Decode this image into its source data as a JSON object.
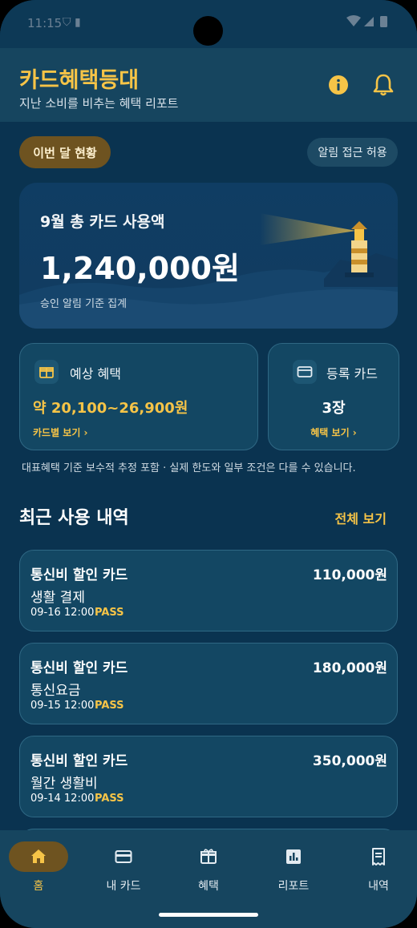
{
  "status_bar": {
    "time": "11:15",
    "left_icons": "⛉ ▮"
  },
  "header": {
    "title": "카드혜택등대",
    "subtitle": "지난 소비를 비추는 혜택 리포트",
    "info_icon": "info-icon",
    "bell_icon": "bell-icon"
  },
  "chips": {
    "month": "이번 달 현황",
    "allow": "알림 접근 허용"
  },
  "hero": {
    "label": "9월 총 카드 사용액",
    "amount": "1,240,000원",
    "note": "승인 알림 기준 집계"
  },
  "benefit_card": {
    "title": "예상 혜택",
    "value": "약 20,100~26,900원",
    "link": "카드별 보기  ›"
  },
  "cards_card": {
    "title": "등록 카드",
    "value": "3장",
    "link": "혜택 보기  ›"
  },
  "disclaimer": "대표혜택 기준 보수적 추정 포함 · 실제 한도와 일부 조건은 다를 수 있습니다.",
  "recent": {
    "title": "최근 사용 내역",
    "see_all": "전체 보기",
    "items": [
      {
        "card": "통신비 할인 카드",
        "category": "생활 결제",
        "datetime": "09-16 12:00",
        "status": "PASS",
        "amount": "110,000원"
      },
      {
        "card": "통신비 할인 카드",
        "category": "통신요금",
        "datetime": "09-15 12:00",
        "status": "PASS",
        "amount": "180,000원"
      },
      {
        "card": "통신비 할인 카드",
        "category": "월간 생활비",
        "datetime": "09-14 12:00",
        "status": "PASS",
        "amount": "350,000원"
      }
    ]
  },
  "nav": [
    {
      "label": "홈",
      "icon": "home-icon",
      "active": true
    },
    {
      "label": "내 카드",
      "icon": "credit-card-icon",
      "active": false
    },
    {
      "label": "혜택",
      "icon": "gift-icon",
      "active": false
    },
    {
      "label": "리포트",
      "icon": "bar-chart-icon",
      "active": false
    },
    {
      "label": "내역",
      "icon": "receipt-icon",
      "active": false
    }
  ],
  "colors": {
    "accent": "#f6c447",
    "background": "#0a3350",
    "surface": "#134763",
    "chip_active": "#6e5320"
  }
}
